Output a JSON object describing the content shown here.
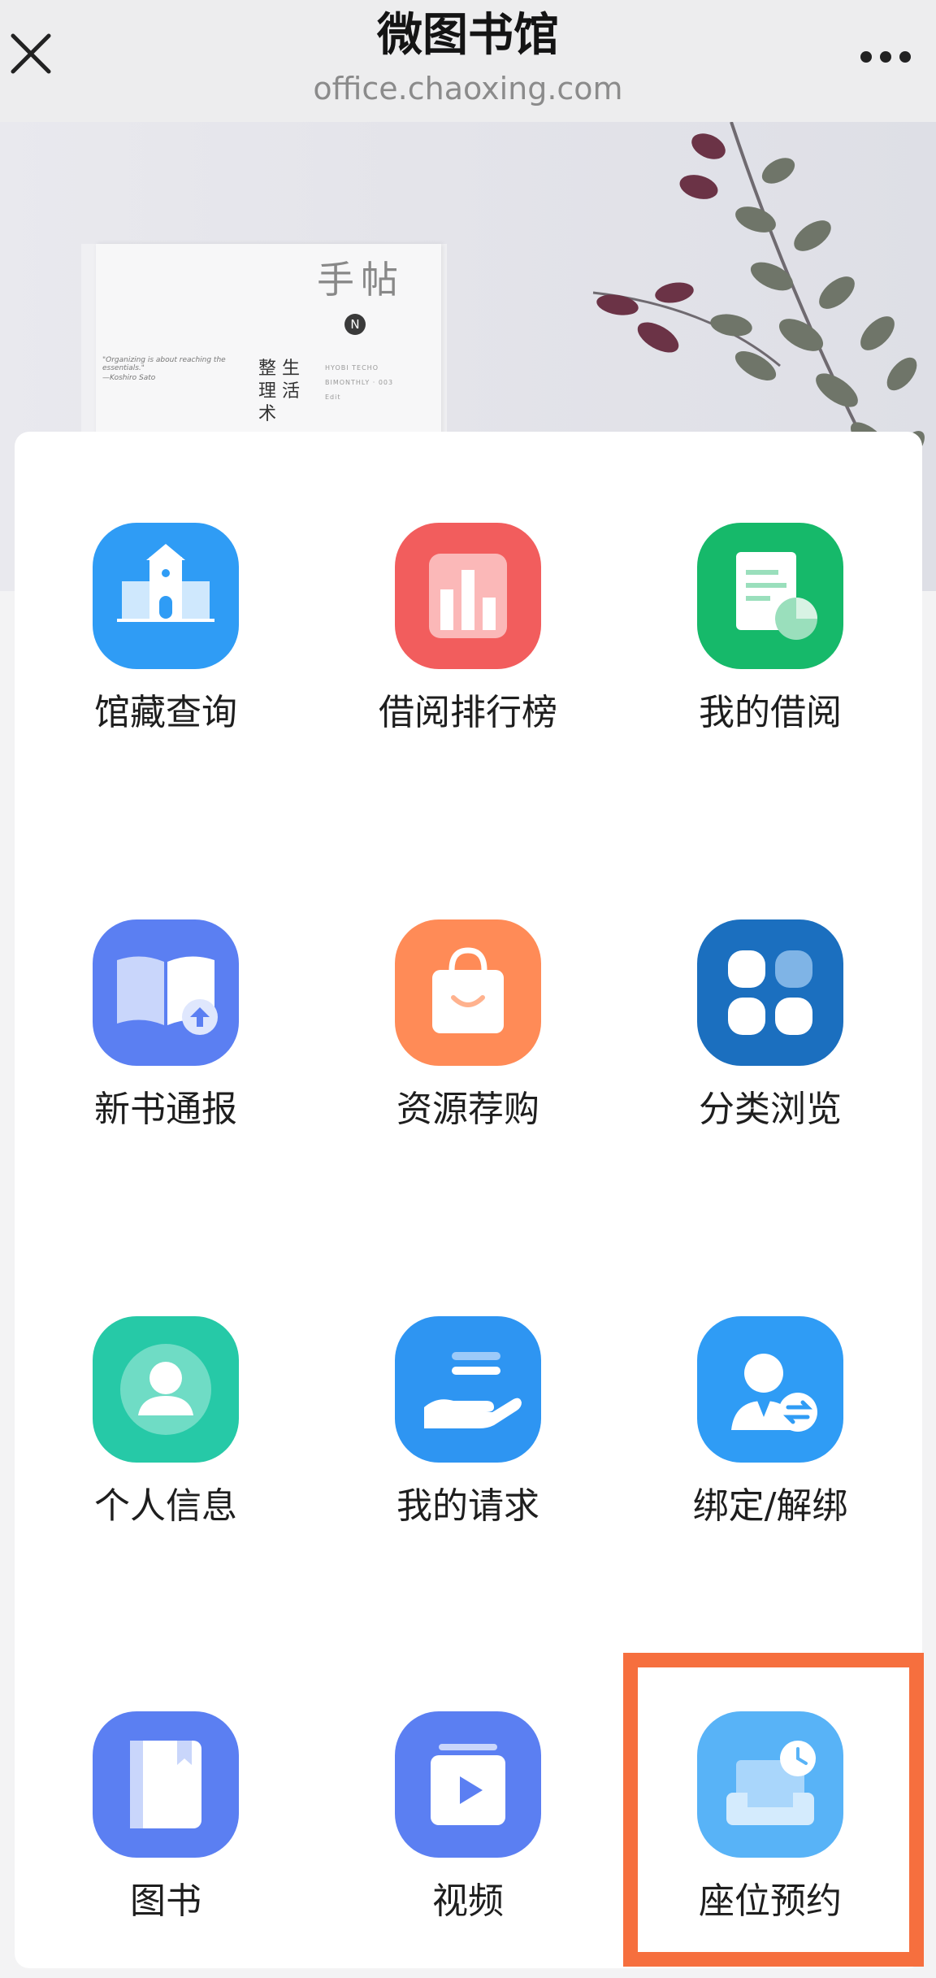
{
  "header": {
    "title": "微图书馆",
    "url": "office.chaoxing.com",
    "close_icon": "close-icon",
    "more_icon": "more-icon"
  },
  "banner": {
    "book_title": "手帖",
    "book_subtitle_1": "整 生",
    "book_subtitle_2": "理 活",
    "book_subtitle_3": "术",
    "book_mark": "N",
    "book_quote": "\"Organizing is about reaching the essentials.\"",
    "book_quote_author": "—Koshiro Sato",
    "book_meta_1": "HYOBI TECHO",
    "book_meta_2": "BIMONTHLY · 003",
    "book_meta_3": "Edit"
  },
  "menu": {
    "items": [
      {
        "label": "馆藏查询",
        "icon": "library-building-icon",
        "color": "#2f9cf5"
      },
      {
        "label": "借阅排行榜",
        "icon": "bar-chart-icon",
        "color": "#f25d5d"
      },
      {
        "label": "我的借阅",
        "icon": "document-pie-icon",
        "color": "#16b96a"
      },
      {
        "label": "新书通报",
        "icon": "open-book-upload-icon",
        "color": "#5b7ff2"
      },
      {
        "label": "资源荐购",
        "icon": "shopping-bag-icon",
        "color": "#ff8b57"
      },
      {
        "label": "分类浏览",
        "icon": "category-grid-icon",
        "color": "#1b6fbf"
      },
      {
        "label": "个人信息",
        "icon": "user-profile-icon",
        "color": "#26c9a7"
      },
      {
        "label": "我的请求",
        "icon": "hand-list-icon",
        "color": "#2e95f2"
      },
      {
        "label": "绑定/解绑",
        "icon": "user-swap-icon",
        "color": "#2f9cf5"
      },
      {
        "label": "图书",
        "icon": "book-icon",
        "color": "#5b7ff2"
      },
      {
        "label": "视频",
        "icon": "video-play-icon",
        "color": "#5b7ff2"
      },
      {
        "label": "座位预约",
        "icon": "seat-clock-icon",
        "color": "#58b3f7"
      }
    ]
  },
  "highlight_color": "#f66f3e"
}
